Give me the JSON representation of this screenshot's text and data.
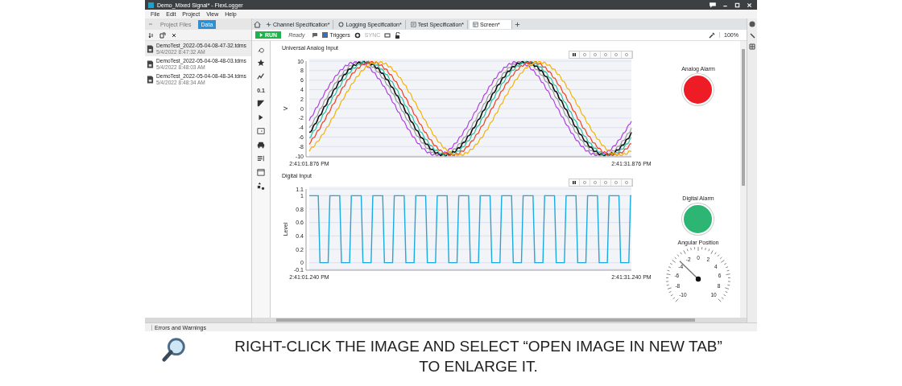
{
  "window": {
    "title": "Demo_Mixed Signal* - FlexLogger"
  },
  "menu": [
    "File",
    "Edit",
    "Project",
    "View",
    "Help"
  ],
  "panel_tabs": [
    {
      "label": "Project Files",
      "selected": false
    },
    {
      "label": "Data",
      "selected": true
    }
  ],
  "files": [
    {
      "name": "DemoTest_2022-05-04-08-47-32.tdms",
      "date": "5/4/2022 8:47:32 AM",
      "selected": true
    },
    {
      "name": "DemoTest_2022-05-04-08-48-03.tdms",
      "date": "5/4/2022 8:48:03 AM",
      "selected": false
    },
    {
      "name": "DemoTest_2022-05-04-08-48-34.tdms",
      "date": "5/4/2022 8:48:34 AM",
      "selected": false
    }
  ],
  "doc_tabs": [
    {
      "label": "Channel Specification*",
      "kind": "channels",
      "selected": false
    },
    {
      "label": "Logging Specification*",
      "kind": "logging",
      "selected": false
    },
    {
      "label": "Test Specification*",
      "kind": "test",
      "selected": false
    },
    {
      "label": "Screen*",
      "kind": "screen",
      "selected": true
    }
  ],
  "toolbar": {
    "run": "RUN",
    "status": "Ready",
    "triggers": {
      "label": "Triggers",
      "checked": true
    },
    "sync": {
      "label": "SYNC",
      "disabled": true
    },
    "zoom": "100%"
  },
  "tools": [
    {
      "kind": "search"
    },
    {
      "kind": "favorite"
    },
    {
      "kind": "chart"
    },
    {
      "kind": "numeric",
      "label": "0.1"
    },
    {
      "kind": "gauge"
    },
    {
      "kind": "play"
    },
    {
      "kind": "panel"
    },
    {
      "kind": "vehicle"
    },
    {
      "kind": "list"
    },
    {
      "kind": "media"
    },
    {
      "kind": "shapes"
    }
  ],
  "charts": [
    {
      "kind": "analog",
      "title": "Universal Analog Input",
      "ylabel": "V",
      "yticks": [
        "10",
        "8",
        "6",
        "4",
        "2",
        "0",
        "-2",
        "-4",
        "-6",
        "-8",
        "-10"
      ],
      "x_start": "2:41:01.876 PM",
      "x_end": "2:41:31.876 PM"
    },
    {
      "kind": "digital",
      "title": "Digital Input",
      "ylabel": "Level",
      "yticks": [
        "1.1",
        "1",
        "0.8",
        "0.6",
        "0.4",
        "0.2",
        "0",
        "-0.1"
      ],
      "x_start": "2:41:01.240 PM",
      "x_end": "2:41:31.240 PM"
    }
  ],
  "indicators": [
    {
      "label": "Analog Alarm",
      "color": "#ee1c25"
    },
    {
      "label": "Digital Alarm",
      "color": "#2db573"
    }
  ],
  "gauge": {
    "label": "Angular Position",
    "ticks": [
      "0",
      "-2",
      "2",
      "-4",
      "4",
      "-6",
      "6",
      "-8",
      "8",
      "-10",
      "10"
    ],
    "level": 0.33
  },
  "status_bar": {
    "label": "Errors and Warnings"
  },
  "caption": "RIGHT-CLICK THE IMAGE AND SELECT “OPEN IMAGE IN NEW TAB”\nTO ENLARGE IT."
}
